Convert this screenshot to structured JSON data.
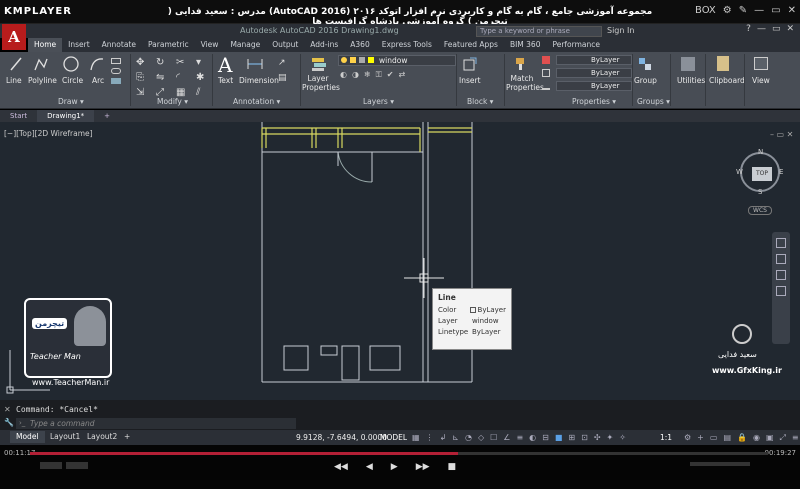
{
  "player": {
    "logo": "KMPLAYER",
    "title": "مجموعه آموزشی جامع ، گام به گام و کاربردی نرم افزار اتوکد ۲۰۱۶ (AutoCAD 2016)  مدرس : سعید فدایی ( تیچرمن ) گروه آموزشی پادشاه گرافیست ها",
    "controls": [
      "BOX",
      "⚙",
      "✎",
      "—",
      "▭",
      "✕"
    ],
    "time_elapsed": "00:11:17",
    "time_total": "00:19:27",
    "progress": 0.58,
    "transport": [
      "◀◀",
      "◀",
      "▶",
      "▶▶",
      "■"
    ]
  },
  "acad": {
    "logo": "A",
    "file_title": "Autodesk AutoCAD 2016   Drawing1.dwg",
    "search_placeholder": "Type a keyword or phrase",
    "sign_in": "Sign In",
    "window_buttons": [
      "?",
      "—",
      "▭",
      "✕"
    ],
    "tabs": [
      "Home",
      "Insert",
      "Annotate",
      "Parametric",
      "View",
      "Manage",
      "Output",
      "Add-ins",
      "A360",
      "Express Tools",
      "Featured Apps",
      "BIM 360",
      "Performance"
    ],
    "active_tab": "Home"
  },
  "ribbon": {
    "draw": {
      "title": "Draw ▾",
      "line": "Line",
      "polyline": "Polyline",
      "circle": "Circle",
      "arc": "Arc"
    },
    "modify": {
      "title": "Modify ▾"
    },
    "annotation": {
      "title": "Annotation ▾",
      "text": "Text",
      "dimension": "Dimension"
    },
    "layers": {
      "title": "Layers ▾",
      "layer_properties": "Layer Properties",
      "current_layer": "window"
    },
    "block": {
      "title": "Block ▾",
      "insert": "Insert"
    },
    "properties": {
      "title": "Properties ▾",
      "match": "Match Properties",
      "color": "ByLayer",
      "linetype": "ByLayer",
      "lineweight": "ByLayer"
    },
    "groups": {
      "title": "Groups ▾",
      "group": "Group"
    },
    "utilities": "Utilities",
    "clipboard": "Clipboard",
    "view": "View"
  },
  "doc_tabs": [
    "Start",
    "Drawing1*",
    "+"
  ],
  "viewport": {
    "label": "[−][Top][2D Wireframe]",
    "compass": {
      "n": "N",
      "s": "S",
      "e": "E",
      "w": "W",
      "top": "TOP",
      "wcs": "WCS"
    }
  },
  "tooltip": {
    "title": "Line",
    "rows": [
      {
        "key": "Color",
        "value": "ByLayer"
      },
      {
        "key": "Layer",
        "value": "window"
      },
      {
        "key": "Linetype",
        "value": "ByLayer"
      }
    ]
  },
  "command": {
    "history": "Command: *Cancel*",
    "placeholder": "Type a command"
  },
  "status": {
    "layout_tabs": [
      "Model",
      "Layout1",
      "Layout2",
      "+"
    ],
    "coords": "9.9128, -7.6494, 0.0000",
    "model": "MODEL",
    "scale": "1:1"
  },
  "watermark": {
    "right_name": "سعید فدایی",
    "right_site": "www.GfxKing.ir",
    "left_badge": "تیچرمن",
    "left_caption": "Teacher Man",
    "left_site": "www.TeacherMan.ir"
  },
  "colors": {
    "accent": "#b71c1c",
    "canvas": "#212830",
    "ribbon": "#484d55",
    "drawing_line": "#c8cdd4",
    "window_layer": "#d8d860",
    "progress": "#b32036"
  }
}
